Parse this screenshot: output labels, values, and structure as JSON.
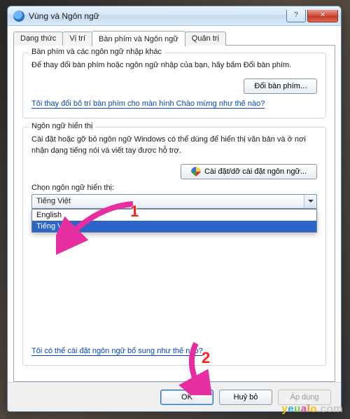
{
  "window": {
    "title": "Vùng và Ngôn ngữ"
  },
  "tabs": {
    "t0": "Dạng thức",
    "t1": "Vị trí",
    "t2": "Bàn phím và Ngôn ngữ",
    "t3": "Quản trị"
  },
  "group_keyboard": {
    "title": "Bàn phím và các ngôn ngữ nhập khác",
    "desc": "Để thay đổi bàn phím hoặc ngôn ngữ nhập của bạn, hãy bấm Đổi bàn phím.",
    "button": "Đổi bàn phím...",
    "link": "Tôi thay đổi bố trí bàn phím cho màn hình Chào mừng như thế nào?"
  },
  "group_display": {
    "title": "Ngôn ngữ hiển thị",
    "desc": "Cài đặt hoặc gỡ bỏ ngôn ngữ Windows có thể dùng để hiển thị văn bản và ở nơi nhận dạng tiếng nói và viết tay được hỗ trợ.",
    "button": "Cài đặt/dỡ cài đặt ngôn ngữ...",
    "choose_label": "Chọn ngôn ngữ hiển thị:",
    "selected": "Tiếng Việt",
    "options": [
      "English",
      "Tiếng Việt"
    ],
    "bottom_link": "Tôi có thể cài đặt ngôn ngữ bổ sung như thế nào?"
  },
  "buttons": {
    "ok": "OK",
    "cancel": "Huỷ bỏ",
    "apply": "Áp dụng"
  },
  "anno": {
    "n1": "1",
    "n2": "2"
  },
  "watermark": {
    "y": "y",
    "e": "e",
    "u": "u",
    "a": "a",
    "l": "l",
    "o": "o",
    "dot": ".",
    "c": "c",
    "o2": "o",
    "m": "m"
  }
}
